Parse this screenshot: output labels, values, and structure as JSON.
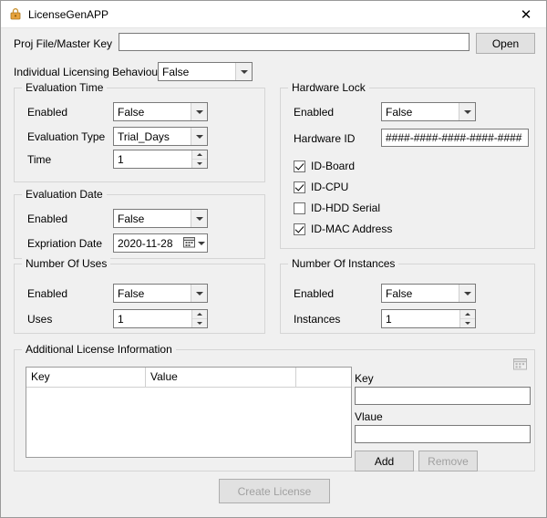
{
  "window": {
    "title": "LicenseGenAPP",
    "close_label": "✕"
  },
  "top": {
    "proj_label": "Proj File/Master Key",
    "proj_value": "",
    "open_label": "Open",
    "individual_label": "Individual Licensing Behaviour",
    "individual_value": "False"
  },
  "evaluation_time": {
    "title": "Evaluation Time",
    "enabled_label": "Enabled",
    "enabled_value": "False",
    "type_label": "Evaluation Type",
    "type_value": "Trial_Days",
    "time_label": "Time",
    "time_value": "1"
  },
  "evaluation_date": {
    "title": "Evaluation Date",
    "enabled_label": "Enabled",
    "enabled_value": "False",
    "expiration_label": "Expriation Date",
    "expiration_value": "2020-11-28"
  },
  "number_of_uses": {
    "title": "Number Of Uses",
    "enabled_label": "Enabled",
    "enabled_value": "False",
    "uses_label": "Uses",
    "uses_value": "1"
  },
  "hardware_lock": {
    "title": "Hardware Lock",
    "enabled_label": "Enabled",
    "enabled_value": "False",
    "hardware_id_label": "Hardware ID",
    "hardware_id_value": "####-####-####-####-####",
    "checkboxes": [
      {
        "label": "ID-Board",
        "checked": true
      },
      {
        "label": "ID-CPU",
        "checked": true
      },
      {
        "label": "ID-HDD Serial",
        "checked": false
      },
      {
        "label": "ID-MAC Address",
        "checked": true
      }
    ]
  },
  "number_of_instances": {
    "title": "Number Of Instances",
    "enabled_label": "Enabled",
    "enabled_value": "False",
    "instances_label": "Instances",
    "instances_value": "1"
  },
  "additional": {
    "title": "Additional License Information",
    "columns": [
      "Key",
      "Value",
      ""
    ],
    "rows": [],
    "key_label": "Key",
    "key_value": "",
    "value_label": "Vlaue",
    "value_value": "",
    "add_label": "Add",
    "remove_label": "Remove"
  },
  "footer": {
    "create_label": "Create License"
  }
}
